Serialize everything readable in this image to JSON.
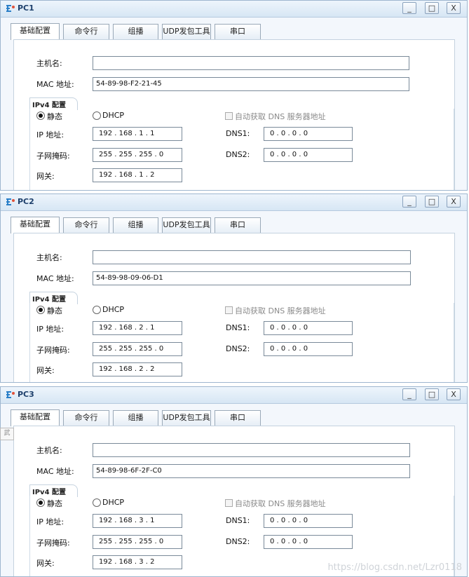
{
  "tabs": [
    "基础配置",
    "命令行",
    "组播",
    "UDP发包工具",
    "串口"
  ],
  "window_buttons": {
    "minimize": "_",
    "maximize": "□",
    "close": "X"
  },
  "labels": {
    "hostname": "主机名:",
    "mac": "MAC 地址:",
    "ipv4_group": "IPv4 配置",
    "static": "静态",
    "dhcp": "DHCP",
    "auto_dns": "自动获取 DNS 服务器地址",
    "ip": "IP 地址:",
    "mask": "子网掩码:",
    "gateway": "网关:",
    "dns1": "DNS1:",
    "dns2": "DNS2:"
  },
  "windows": [
    {
      "title": "PC1",
      "hostname": "",
      "mac": "54-89-98-F2-21-45",
      "ip": "192 . 168 . 1 . 1",
      "mask": "255 . 255 . 255 . 0",
      "gateway": "192 . 168 . 1 . 2",
      "dns1": "0 . 0 . 0 . 0",
      "dns2": "0 . 0 . 0 . 0"
    },
    {
      "title": "PC2",
      "hostname": "",
      "mac": "54-89-98-09-06-D1",
      "ip": "192 . 168 . 2 . 1",
      "mask": "255 . 255 . 255 . 0",
      "gateway": "192 . 168 . 2 . 2",
      "dns1": "0 . 0 . 0 . 0",
      "dns2": "0 . 0 . 0 . 0"
    },
    {
      "title": "PC3",
      "hostname": "",
      "mac": "54-89-98-6F-2F-C0",
      "ip": "192 . 168 . 3 . 1",
      "mask": "255 . 255 . 255 . 0",
      "gateway": "192 . 168 . 3 . 2",
      "dns1": "0 . 0 . 0 . 0",
      "dns2": "0 . 0 . 0 . 0"
    }
  ],
  "side_fragment": "武",
  "watermark": "https://blog.csdn.net/Lzr0118",
  "colors": {
    "titlebar_text": "#1d3f6b",
    "window_border": "#9eb6cf"
  }
}
